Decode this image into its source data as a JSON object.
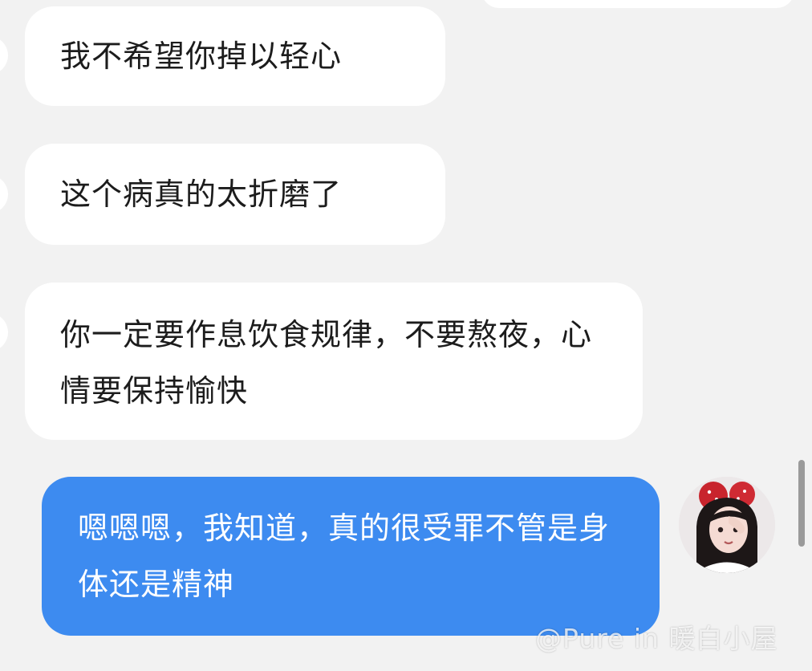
{
  "messages": [
    {
      "direction": "incoming",
      "text": "我不希望你掉以轻心"
    },
    {
      "direction": "incoming",
      "text": "这个病真的太折磨了"
    },
    {
      "direction": "incoming",
      "text": "你一定要作息饮食规律，不要熬夜，心情要保持愉快"
    },
    {
      "direction": "outgoing",
      "text": "嗯嗯嗯，我知道，真的很受罪不管是身体还是精神"
    }
  ],
  "watermark": "@Pure in 暖白小屋",
  "colors": {
    "background": "#f2f2f2",
    "incoming_bubble": "#ffffff",
    "outgoing_bubble": "#3d8bf0",
    "text": "#1c1c1c"
  },
  "icons": {
    "self_avatar": "user-avatar-photo"
  }
}
